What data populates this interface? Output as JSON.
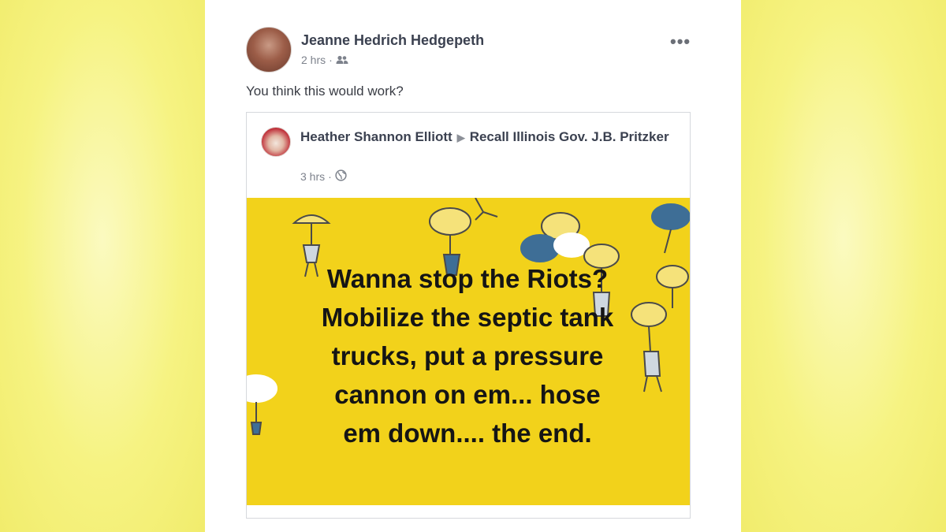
{
  "post": {
    "author": "Jeanne Hedrich Hedgepeth",
    "time": "2 hrs",
    "separator": "·",
    "audience_icon": "friends-icon",
    "more_icon": "more-options-icon",
    "more_label": "•••",
    "text": "You think this would work?"
  },
  "shared_post": {
    "author": "Heather Shannon Elliott",
    "arrow": "▶",
    "group": "Recall Illinois Gov. J.B. Pritzker",
    "time": "3 hrs",
    "separator": "·",
    "audience_icon": "globe-icon",
    "image_text": "Wanna stop the Riots?\nMobilize the septic tank\ntrucks, put a pressure\ncannon on em... hose\nem down.... the end."
  },
  "colors": {
    "meme_background": "#f2d21b",
    "page_background": "#f6f28a",
    "doodle_umbrella_blue": "#3e6e96",
    "doodle_umbrella_white": "#ffffff"
  }
}
